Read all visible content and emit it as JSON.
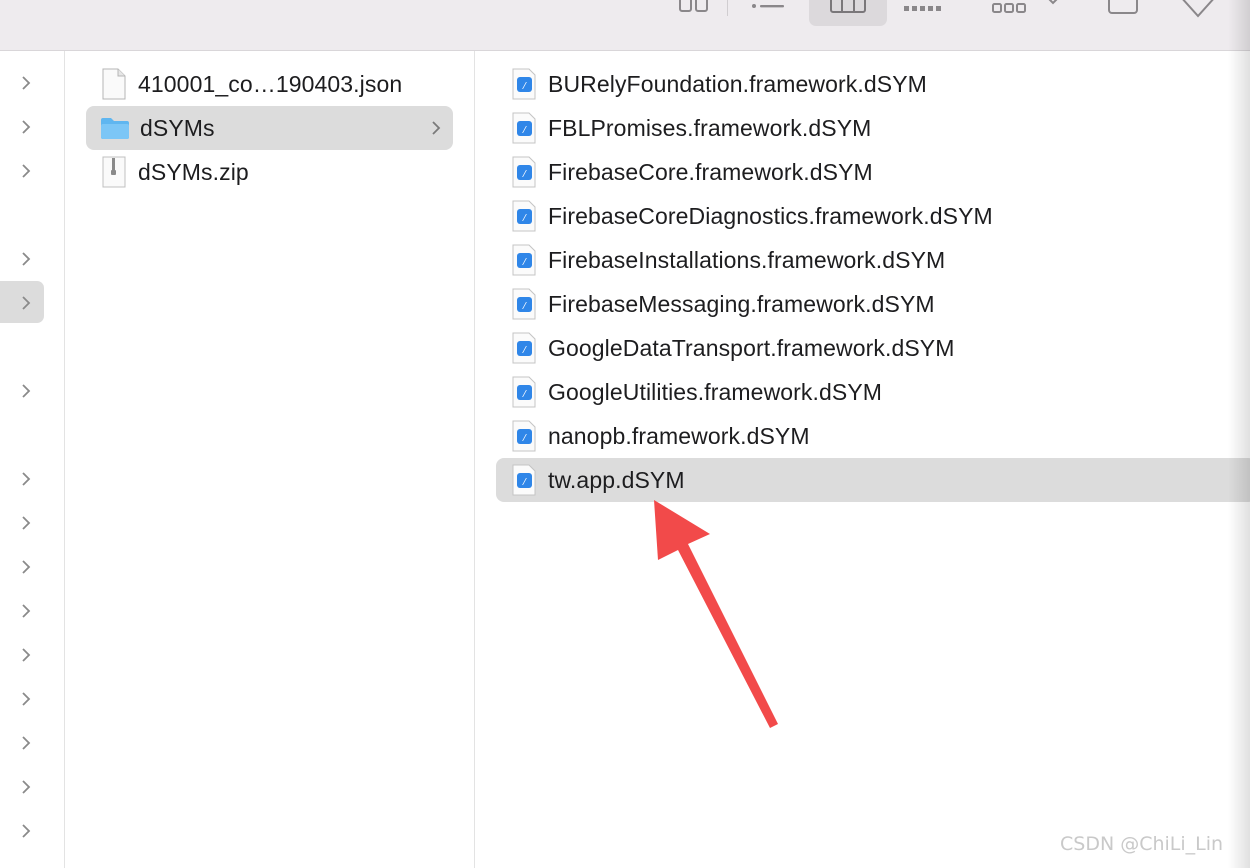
{
  "column2": {
    "items": [
      {
        "name": "410001_co…190403.json",
        "kind": "json-file-icon"
      },
      {
        "name": "dSYMs",
        "kind": "folder-icon",
        "selected": true
      },
      {
        "name": "dSYMs.zip",
        "kind": "zip-file-icon"
      }
    ]
  },
  "column3": {
    "items": [
      {
        "name": "BURelyFoundation.framework.dSYM"
      },
      {
        "name": "FBLPromises.framework.dSYM"
      },
      {
        "name": "FirebaseCore.framework.dSYM"
      },
      {
        "name": "FirebaseCoreDiagnostics.framework.dSYM"
      },
      {
        "name": "FirebaseInstallations.framework.dSYM"
      },
      {
        "name": "FirebaseMessaging.framework.dSYM"
      },
      {
        "name": "GoogleDataTransport.framework.dSYM"
      },
      {
        "name": "GoogleUtilities.framework.dSYM"
      },
      {
        "name": "nanopb.framework.dSYM"
      },
      {
        "name": "tw.app.dSYM",
        "selected": true
      }
    ]
  },
  "watermark": "CSDN @ChiLi_Lin",
  "colors": {
    "selection": "#dcdcdc",
    "toolbar": "#eeebee",
    "arrow": "#f24a4a",
    "folder": "#5fb6f0"
  }
}
